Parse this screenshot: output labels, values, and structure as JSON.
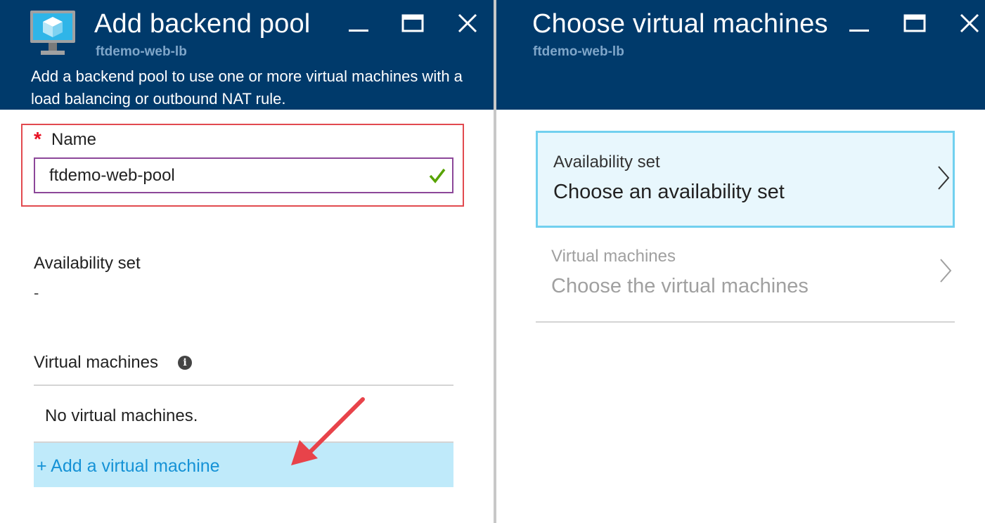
{
  "left_blade": {
    "title": "Add backend pool",
    "subtitle": "ftdemo-web-lb",
    "description": "Add a backend pool to use one or more virtual machines with a load balancing or outbound NAT rule.",
    "form": {
      "required_marker": "*",
      "name_label": "Name",
      "name_value": "ftdemo-web-pool",
      "availability_set_label": "Availability set",
      "availability_set_value": "-",
      "virtual_machines_label": "Virtual machines",
      "info_icon_glyph": "i",
      "no_vms_text": "No virtual machines.",
      "add_vm_label": "+ Add a virtual machine"
    }
  },
  "right_blade": {
    "title": "Choose virtual machines",
    "subtitle": "ftdemo-web-lb",
    "pickers": [
      {
        "label": "Availability set",
        "value": "Choose an availability set",
        "state": "selected"
      },
      {
        "label": "Virtual machines",
        "value": "Choose the virtual machines",
        "state": "disabled"
      }
    ]
  },
  "icons": {
    "app": "virtual-machine-icon",
    "minimize": "minimize-icon",
    "maximize": "maximize-icon",
    "close": "close-icon",
    "valid": "checkmark-icon",
    "info": "info-icon",
    "chevron": "chevron-right-icon",
    "annotation": "red-arrow-annotation"
  },
  "colors": {
    "header_bg": "#003a6b",
    "subtitle": "#7fa6c9",
    "highlight_border": "#e24a4f",
    "input_border": "#8c4799",
    "valid_check": "#57a300",
    "add_vm_bg": "#bfeafa",
    "add_vm_text": "#1592d6",
    "picker_selected_bg": "#e8f7fd",
    "picker_selected_border": "#71d0ef"
  }
}
